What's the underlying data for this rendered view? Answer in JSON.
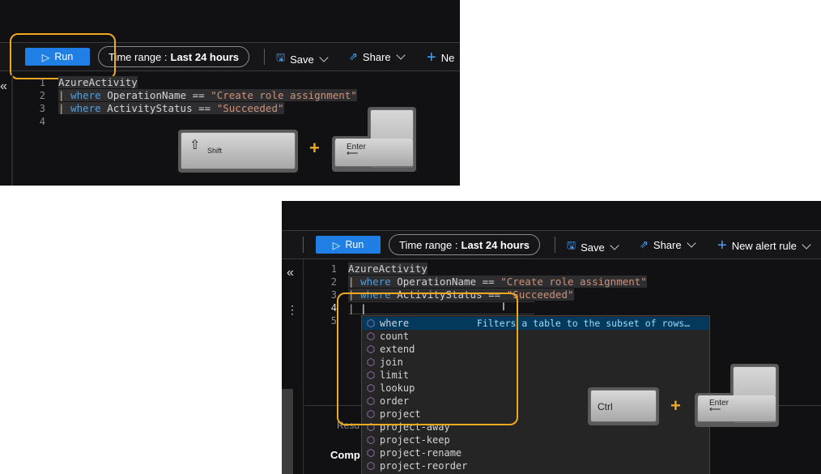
{
  "top": {
    "toolbar": {
      "run_label": "Run",
      "time_range_prefix": "Time range :",
      "time_range_value": "Last 24 hours",
      "save_label": "Save",
      "share_label": "Share",
      "new_label": "Ne"
    },
    "lines": [
      {
        "num": "1",
        "text": "AzureActivity"
      },
      {
        "num": "2",
        "kw": "where",
        "field": "OperationName",
        "op": "==",
        "str": "\"Create role assignment\""
      },
      {
        "num": "3",
        "kw": "where",
        "field": "ActivityStatus",
        "op": "==",
        "str": "\"Succeeded\""
      },
      {
        "num": "4"
      }
    ],
    "keys": {
      "shift": "Shift",
      "enter": "Enter",
      "plus": "+"
    }
  },
  "bottom": {
    "toolbar": {
      "run_label": "Run",
      "time_range_prefix": "Time range :",
      "time_range_value": "Last 24 hours",
      "save_label": "Save",
      "share_label": "Share",
      "new_alert_label": "New alert rule"
    },
    "lines": [
      {
        "num": "1",
        "text": "AzureActivity"
      },
      {
        "num": "2",
        "kw": "where",
        "field": "OperationName",
        "op": "==",
        "str": "\"Create role assignment\""
      },
      {
        "num": "3",
        "kw": "where",
        "field": "ActivityStatus",
        "op": "==",
        "str": "\"Succeeded\""
      },
      {
        "num": "4"
      },
      {
        "num": "5"
      }
    ],
    "suggestions": [
      {
        "label": "where",
        "desc": "Filters a table to the subset of rows…"
      },
      {
        "label": "count"
      },
      {
        "label": "extend"
      },
      {
        "label": "join"
      },
      {
        "label": "limit"
      },
      {
        "label": "lookup"
      },
      {
        "label": "order"
      },
      {
        "label": "project"
      },
      {
        "label": "project-away"
      },
      {
        "label": "project-keep"
      },
      {
        "label": "project-rename"
      },
      {
        "label": "project-reorder"
      }
    ],
    "results_tab": "Resu",
    "comp_label": "Comp",
    "keys": {
      "ctrl": "Ctrl",
      "enter": "Enter",
      "plus": "+"
    }
  },
  "colors": {
    "accent": "#f0a81f",
    "run": "#1f7fe5",
    "keyword": "#569cd6",
    "string": "#ce9178"
  }
}
